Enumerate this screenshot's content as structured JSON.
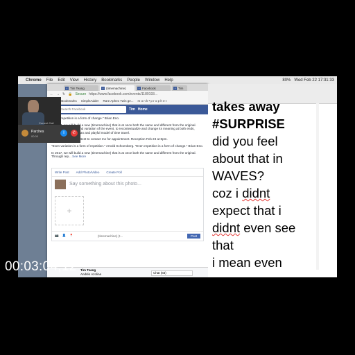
{
  "menubar": {
    "app": "Chrome",
    "items": [
      "File",
      "Edit",
      "View",
      "History",
      "Bookmarks",
      "People",
      "Window",
      "Help"
    ],
    "status": "Wed Feb 22  17:31:33",
    "battery": "80%"
  },
  "call": {
    "cam_label": "Current Call",
    "name": "Parches",
    "time": "00:00"
  },
  "browser": {
    "tabs": [
      "Tim Teang",
      "(timemachine)",
      "Facebook",
      "Tim"
    ],
    "address": "https://www.facebook.com/events/1189193...",
    "secure_label": "Secure",
    "bookmarks": [
      "Apps",
      "Bookmarks",
      "SimpleAdder",
      "Rare Aphex Twin ge...",
      "m o n k • p r o p h e t"
    ],
    "fb": {
      "search_placeholder": "Search Facebook",
      "user": "Tim",
      "home": "Home"
    },
    "paragraphs": [
      "\"Even repetition is a form of change.\" Brian Eno.",
      "In 2017, we will build a new (timemachine) that is at once both the same and different from the original. Through repetition and variation of the event, to recontextualize and change its meaning at both ends, proposing a nonhuman and playful model of time travel.",
      "Open Feb 21 - 27 // Best to contact me for appointment. Reception Feb 23 at 8pm.",
      "\"Even variation is a form of repetition.\" Arnold Schoenberg. \"Even repetition is a form of change.\" Brian Eno.",
      "In 2017, we will build a new (timemachine) that is at once both the same and different from the original. Through rep..."
    ],
    "see_more": "See More",
    "composer": {
      "write_post": "Write Post",
      "add_photo": "Add Photo/Video",
      "create_poll": "Create Poll",
      "placeholder": "Say something about this photo...",
      "audience": "(timemachine) (t...",
      "post": "Post"
    },
    "chatbar": {
      "name1": "Tim Teang",
      "name2": "Andrés Azolina",
      "chat": "Chat (83)"
    }
  },
  "notes": {
    "lines": [
      {
        "text": "takes away",
        "style": "bold"
      },
      {
        "text": "#SURPRISE",
        "style": "bold"
      },
      {
        "text": "did you feel",
        "style": "normal"
      },
      {
        "text": "about that in",
        "style": "normal"
      },
      {
        "text": "WAVES?",
        "style": "normal"
      },
      {
        "text": "coz i ",
        "style": "normal",
        "squig": "didnt"
      },
      {
        "text": "expect that i",
        "style": "normal"
      },
      {
        "squig": "didnt",
        "text": " even see",
        "style": "normal"
      },
      {
        "text": "that",
        "style": "normal"
      },
      {
        "text": "i mean even",
        "style": "normal"
      }
    ]
  },
  "timecode": "00:03:04;12"
}
